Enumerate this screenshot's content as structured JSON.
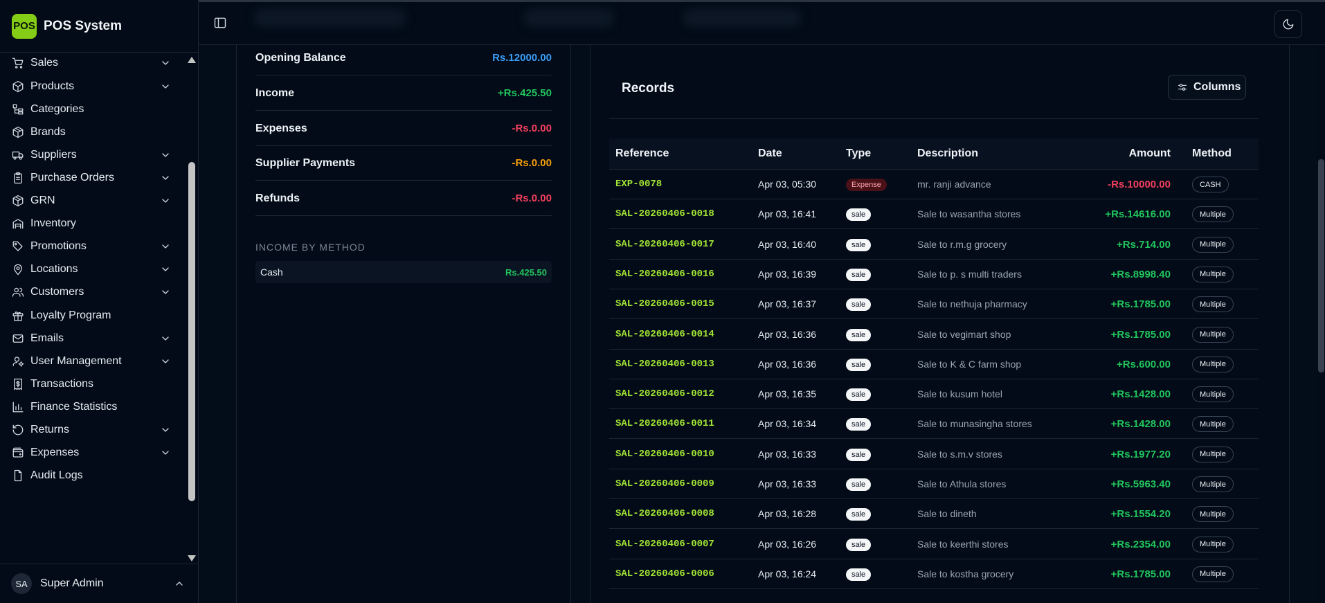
{
  "brand": {
    "logo": "POS",
    "name": "POS System"
  },
  "nav": [
    {
      "label": "Sales",
      "icon": "cart-icon",
      "chevron": true
    },
    {
      "label": "Products",
      "icon": "package-icon",
      "chevron": true
    },
    {
      "label": "Categories",
      "icon": "categories-icon",
      "chevron": false
    },
    {
      "label": "Brands",
      "icon": "box-icon",
      "chevron": false
    },
    {
      "label": "Suppliers",
      "icon": "truck-icon",
      "chevron": true
    },
    {
      "label": "Purchase Orders",
      "icon": "clipboard-icon",
      "chevron": true
    },
    {
      "label": "GRN",
      "icon": "box-icon",
      "chevron": true
    },
    {
      "label": "Inventory",
      "icon": "warehouse-icon",
      "chevron": false
    },
    {
      "label": "Promotions",
      "icon": "tag-icon",
      "chevron": true
    },
    {
      "label": "Locations",
      "icon": "map-pin-icon",
      "chevron": true
    },
    {
      "label": "Customers",
      "icon": "users-icon",
      "chevron": true
    },
    {
      "label": "Loyalty Program",
      "icon": "gift-icon",
      "chevron": false
    },
    {
      "label": "Emails",
      "icon": "mail-icon",
      "chevron": true
    },
    {
      "label": "User Management",
      "icon": "user-cog-icon",
      "chevron": true
    },
    {
      "label": "Transactions",
      "icon": "receipt-icon",
      "chevron": false
    },
    {
      "label": "Finance Statistics",
      "icon": "bar-chart-icon",
      "chevron": false
    },
    {
      "label": "Returns",
      "icon": "rotate-ccw-icon",
      "chevron": true
    },
    {
      "label": "Expenses",
      "icon": "wallet-icon",
      "chevron": true
    },
    {
      "label": "Audit Logs",
      "icon": "file-icon",
      "chevron": false
    }
  ],
  "user": {
    "initials": "SA",
    "name": "Super Admin"
  },
  "summary": [
    {
      "label": "Opening Balance",
      "value": "Rs.12000.00",
      "color": "#3b9cf6"
    },
    {
      "label": "Income",
      "value": "+Rs.425.50",
      "color": "#22c55e"
    },
    {
      "label": "Expenses",
      "value": "-Rs.0.00",
      "color": "#f43f5e"
    },
    {
      "label": "Supplier Payments",
      "value": "-Rs.0.00",
      "color": "#f59e0b"
    },
    {
      "label": "Refunds",
      "value": "-Rs.0.00",
      "color": "#f43f5e"
    }
  ],
  "income_by_method": {
    "title": "INCOME BY METHOD",
    "rows": [
      {
        "label": "Cash",
        "value": "Rs.425.50"
      }
    ]
  },
  "records": {
    "title": "Records",
    "columns_button": "Columns",
    "headers": {
      "reference": "Reference",
      "date": "Date",
      "type": "Type",
      "description": "Description",
      "amount": "Amount",
      "method": "Method"
    },
    "rows": [
      {
        "ref": "EXP-0078",
        "date": "Apr 03, 05:30",
        "type": "Expense",
        "desc": "mr. ranji advance",
        "amount": "-Rs.10000.00",
        "method": "CASH"
      },
      {
        "ref": "SAL-20260406-0018",
        "date": "Apr 03, 16:41",
        "type": "sale",
        "desc": "Sale to wasantha stores",
        "amount": "+Rs.14616.00",
        "method": "Multiple"
      },
      {
        "ref": "SAL-20260406-0017",
        "date": "Apr 03, 16:40",
        "type": "sale",
        "desc": "Sale to r.m.g grocery",
        "amount": "+Rs.714.00",
        "method": "Multiple"
      },
      {
        "ref": "SAL-20260406-0016",
        "date": "Apr 03, 16:39",
        "type": "sale",
        "desc": "Sale to p. s multi traders",
        "amount": "+Rs.8998.40",
        "method": "Multiple"
      },
      {
        "ref": "SAL-20260406-0015",
        "date": "Apr 03, 16:37",
        "type": "sale",
        "desc": "Sale to nethuja pharmacy",
        "amount": "+Rs.1785.00",
        "method": "Multiple"
      },
      {
        "ref": "SAL-20260406-0014",
        "date": "Apr 03, 16:36",
        "type": "sale",
        "desc": "Sale to vegimart shop",
        "amount": "+Rs.1785.00",
        "method": "Multiple"
      },
      {
        "ref": "SAL-20260406-0013",
        "date": "Apr 03, 16:36",
        "type": "sale",
        "desc": "Sale to K & C farm shop",
        "amount": "+Rs.600.00",
        "method": "Multiple"
      },
      {
        "ref": "SAL-20260406-0012",
        "date": "Apr 03, 16:35",
        "type": "sale",
        "desc": "Sale to kusum hotel",
        "amount": "+Rs.1428.00",
        "method": "Multiple"
      },
      {
        "ref": "SAL-20260406-0011",
        "date": "Apr 03, 16:34",
        "type": "sale",
        "desc": "Sale to munasingha stores",
        "amount": "+Rs.1428.00",
        "method": "Multiple"
      },
      {
        "ref": "SAL-20260406-0010",
        "date": "Apr 03, 16:33",
        "type": "sale",
        "desc": "Sale to s.m.v stores",
        "amount": "+Rs.1977.20",
        "method": "Multiple"
      },
      {
        "ref": "SAL-20260406-0009",
        "date": "Apr 03, 16:33",
        "type": "sale",
        "desc": "Sale to Athula stores",
        "amount": "+Rs.5963.40",
        "method": "Multiple"
      },
      {
        "ref": "SAL-20260406-0008",
        "date": "Apr 03, 16:28",
        "type": "sale",
        "desc": "Sale to dineth",
        "amount": "+Rs.1554.20",
        "method": "Multiple"
      },
      {
        "ref": "SAL-20260406-0007",
        "date": "Apr 03, 16:26",
        "type": "sale",
        "desc": "Sale to keerthi stores",
        "amount": "+Rs.2354.00",
        "method": "Multiple"
      },
      {
        "ref": "SAL-20260406-0006",
        "date": "Apr 03, 16:24",
        "type": "sale",
        "desc": "Sale to kostha grocery",
        "amount": "+Rs.1785.00",
        "method": "Multiple"
      }
    ]
  },
  "colors": {
    "accent": "#84cc16",
    "income": "#22c55e",
    "expense": "#f43f5e",
    "opening": "#3b9cf6",
    "supplier": "#f59e0b",
    "reference": "#a3e635"
  }
}
